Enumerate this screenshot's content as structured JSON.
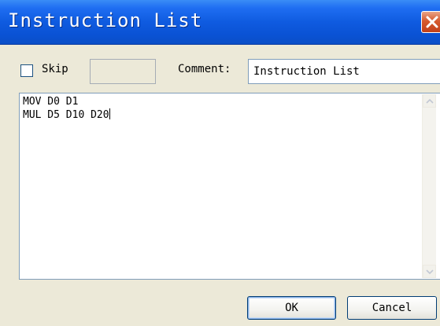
{
  "window": {
    "title": "Instruction List"
  },
  "form": {
    "skip_label": "Skip",
    "skip_checked": false,
    "skip_value": "",
    "comment_label": "Comment:",
    "comment_value": "Instruction List"
  },
  "editor": {
    "lines": [
      "MOV D0 D1",
      "MUL D5 D10 D20"
    ]
  },
  "buttons": {
    "ok_label": "OK",
    "cancel_label": "Cancel"
  },
  "icons": {
    "close": "close-icon",
    "scroll_up": "scroll-up-arrow-icon",
    "scroll_down": "scroll-down-arrow-icon"
  },
  "colors": {
    "titlebar": "#0a52d4",
    "close_button": "#d65a2e",
    "dialog_bg": "#ece9d8"
  }
}
